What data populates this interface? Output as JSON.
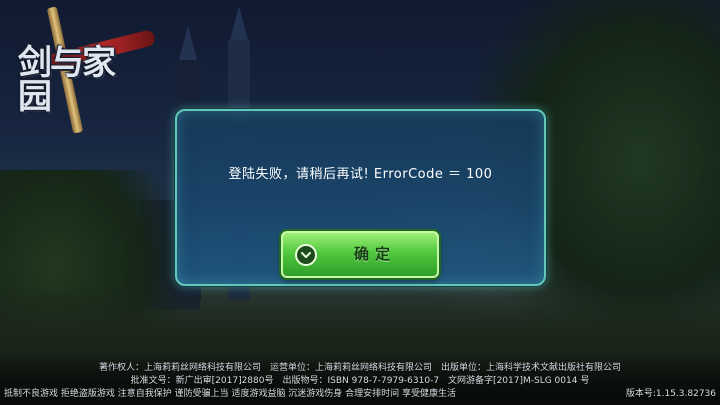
{
  "logo": {
    "title": "剑与家园"
  },
  "dialog": {
    "message": "登陆失败，请稍后再试! ErrorCode ＝ 100",
    "confirm_label": "确定",
    "confirm_icon": "chevron-down-circle-icon",
    "border_color": "#63c8b8",
    "button_color": "#52c83e"
  },
  "footer": {
    "line1": "著作权人：上海莉莉丝网络科技有限公司　运营单位：上海莉莉丝网络科技有限公司　出版单位：上海科学技术文献出版社有限公司",
    "line2": "批准文号：新广出审[2017]2880号　出版物号：ISBN 978-7-7979-6310-7　文网游备字[2017]M-SLG 0014 号",
    "line3": "抵制不良游戏 拒绝盗版游戏 注意自我保护 谨防受骗上当 适度游戏益脑 沉迷游戏伤身 合理安排时间 享受健康生活",
    "version": "版本号:1.15.3.82736"
  }
}
